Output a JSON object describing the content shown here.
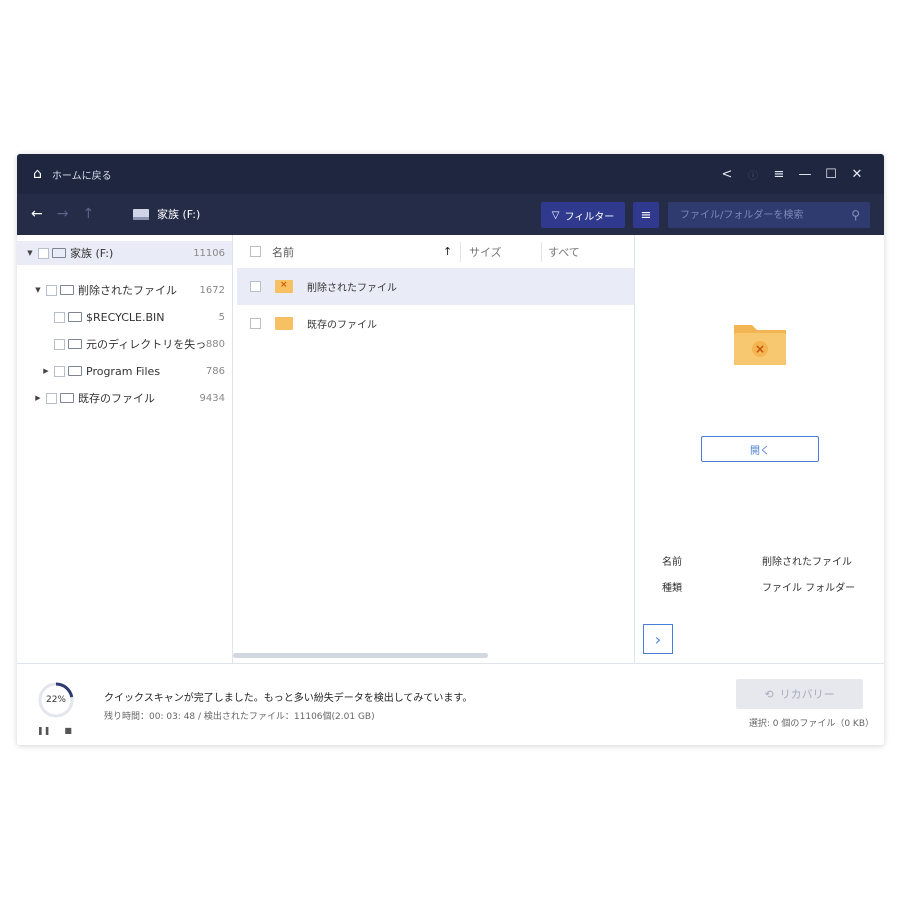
{
  "titlebar": {
    "home_label": "ホームに戻る",
    "controls": [
      "share-icon",
      "menu-icon",
      "minimize-icon",
      "maximize-icon",
      "close-icon"
    ]
  },
  "toolbar": {
    "location": "家族 (F:)",
    "filter_label": "フィルター",
    "search_placeholder": "ファイル/フォルダーを検索"
  },
  "tree": {
    "items": [
      {
        "label": "家族 (F:)",
        "count": "11106",
        "expanded": true,
        "selected": true,
        "level": 0
      },
      {
        "label": "削除されたファイル",
        "count": "1672",
        "expanded": true,
        "level": 1
      },
      {
        "label": "$RECYCLE.BIN",
        "count": "5",
        "level": 2
      },
      {
        "label": "元のディレクトリを失った…",
        "count": "880",
        "level": 2
      },
      {
        "label": "Program Files",
        "count": "786",
        "expanded": false,
        "level": 2
      },
      {
        "label": "既存のファイル",
        "count": "9434",
        "expanded": false,
        "level": 0
      }
    ]
  },
  "list": {
    "columns": {
      "name": "名前",
      "size": "サイズ",
      "type": "すべて"
    },
    "sort_icon": "sort-ascending-icon",
    "rows": [
      {
        "name": "削除されたファイル",
        "selected": true,
        "icon": "deleted-folder-icon"
      },
      {
        "name": "既存のファイル",
        "selected": false,
        "icon": "folder-icon"
      }
    ]
  },
  "preview": {
    "open_label": "開く",
    "props": {
      "name_key": "名前",
      "name_value": "削除されたファイル",
      "type_key": "種類",
      "type_value": "ファイル フォルダー"
    }
  },
  "status": {
    "progress_pct": 22,
    "progress_label": "22%",
    "message": "クイックスキャンが完了しました。もっと多い紛失データを検出してみています。",
    "detail": "残り時間：00: 03: 48 / 検出されたファイル：11106個(2.01 GB)",
    "recover_label": "リカバリー",
    "selection_info": "選択: 0 個のファイル（0 KB）"
  },
  "colors": {
    "titlebar": "#1e2640",
    "toolbar": "#242c48",
    "accent": "#2f3a8f",
    "link": "#4a7fd8",
    "folder": "#f6c063"
  }
}
